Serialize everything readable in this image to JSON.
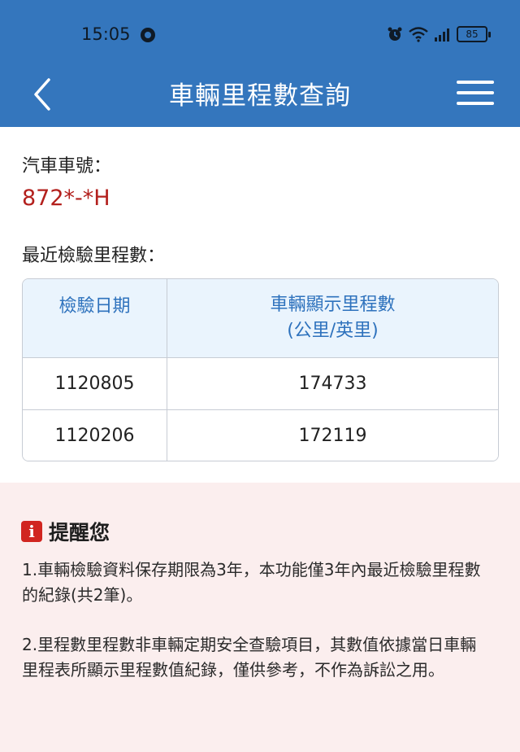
{
  "status_bar": {
    "time": "15:05",
    "battery": "85",
    "icons": [
      "app-notification-icon",
      "alarm-icon",
      "wifi-icon",
      "signal-icon",
      "battery-icon"
    ]
  },
  "app_bar": {
    "title": "車輛里程數查詢",
    "back_icon": "chevron-left-icon",
    "menu_icon": "hamburger-menu-icon",
    "color": "#3476bd"
  },
  "vehicle": {
    "plate_label": "汽車車號：",
    "plate_value": "872*-*H",
    "plate_color": "#b3201d"
  },
  "mileage": {
    "section_label": "最近檢驗里程數：",
    "headers": {
      "date": "檢驗日期",
      "reading_line1": "車輛顯示里程數",
      "reading_line2": "(公里/英里)"
    },
    "rows": [
      {
        "date": "1120805",
        "reading": "174733"
      },
      {
        "date": "1120206",
        "reading": "172119"
      }
    ]
  },
  "reminder": {
    "icon": "info-icon",
    "title": "提醒您",
    "notes": [
      "1.車輛檢驗資料保存期限為3年，本功能僅3年內最近檢驗里程數的紀錄(共2筆)。",
      "2.里程數里程數非車輛定期安全查驗項目，其數值依據當日車輛里程表所顯示里程數值紀錄，僅供參考，不作為訴訟之用。"
    ]
  }
}
